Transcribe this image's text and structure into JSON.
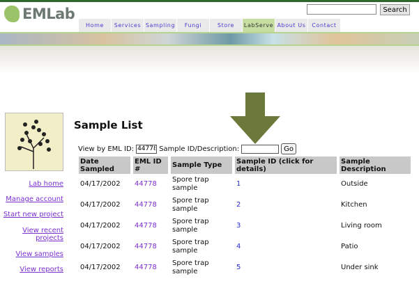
{
  "header": {
    "logo_text": "EMLab",
    "search_placeholder": "",
    "search_button": "Search"
  },
  "nav": [
    {
      "label": "Home"
    },
    {
      "label": "Services"
    },
    {
      "label": "Sampling"
    },
    {
      "label": "Fungi"
    },
    {
      "label": "Store"
    },
    {
      "label": "LabServe",
      "active": true
    },
    {
      "label": "About Us"
    },
    {
      "label": "Contact"
    }
  ],
  "sidebar": {
    "links": [
      "Lab home",
      "Manage account",
      "Start new project",
      "View recent projects",
      "View samples",
      "View reports"
    ]
  },
  "main": {
    "title": "Sample List",
    "filter": {
      "eml_label": "View by EML ID:",
      "eml_value": "44778",
      "desc_label": "Sample ID/Description:",
      "desc_value": "",
      "go": "Go"
    },
    "columns": [
      "Date Sampled",
      "EML ID #",
      "Sample Type",
      "Sample ID (click for details)",
      "Sample Description"
    ],
    "rows": [
      {
        "date": "04/17/2002",
        "eml": "44778",
        "type": "Spore trap sample",
        "id": "1",
        "desc": "Outside"
      },
      {
        "date": "04/17/2002",
        "eml": "44778",
        "type": "Spore trap sample",
        "id": "2",
        "desc": "Kitchen"
      },
      {
        "date": "04/17/2002",
        "eml": "44778",
        "type": "Spore trap sample",
        "id": "3",
        "desc": "Living room"
      },
      {
        "date": "04/17/2002",
        "eml": "44778",
        "type": "Spore trap sample",
        "id": "4",
        "desc": "Patio"
      },
      {
        "date": "04/17/2002",
        "eml": "44778",
        "type": "Spore trap sample",
        "id": "5",
        "desc": "Under sink"
      }
    ]
  },
  "colors": {
    "brand_green": "#2e6a2e",
    "active_tab": "#c7dea3",
    "arrow": "#6b7a3a",
    "link": "#7b2fd0"
  }
}
